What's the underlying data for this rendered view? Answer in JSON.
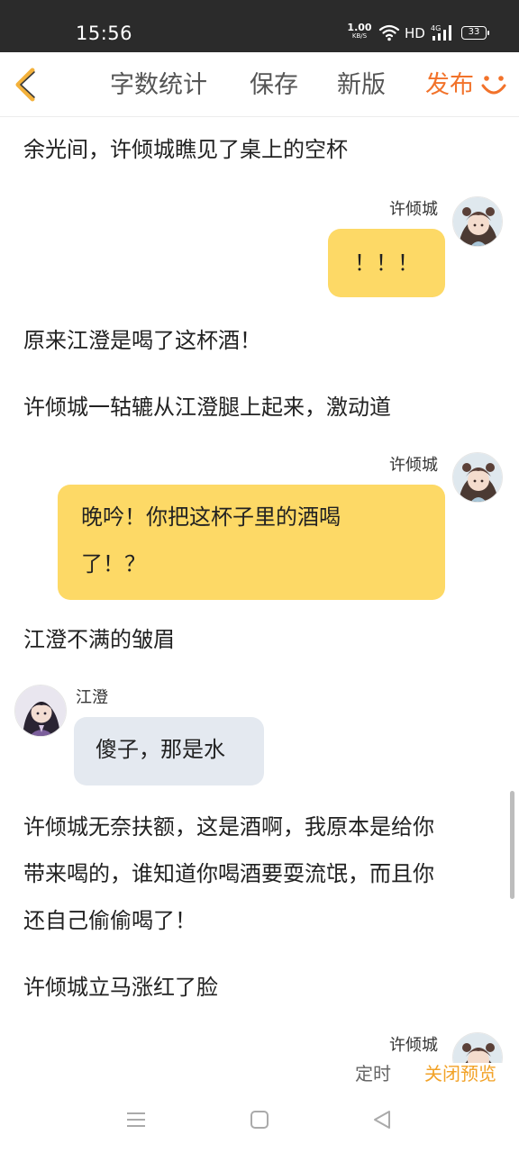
{
  "status_bar": {
    "time": "15:56",
    "net_speed_value": "1.00",
    "net_speed_unit": "KB/S",
    "hd_label": "HD",
    "signal_label": "4G",
    "battery_level": "33"
  },
  "toolbar": {
    "word_count_label": "字数统计",
    "save_label": "保存",
    "new_version_label": "新版",
    "publish_label": "发布"
  },
  "story": {
    "paragraphs": [
      "余光间，许倾城瞧见了桌上的空杯",
      "原来江澄是喝了这杯酒！",
      "许倾城一轱辘从江澄腿上起来，激动道",
      "江澄不满的皱眉",
      "许倾城无奈扶额，这是酒啊，我原本是给你",
      "带来喝的，谁知道你喝酒要耍流氓，而且你",
      "还自己偷偷喝了！",
      "许倾城立马涨红了脸"
    ],
    "messages": [
      {
        "speaker": "许倾城",
        "text": "！！！"
      },
      {
        "speaker": "许倾城",
        "line1": "晚吟！你把这杯子里的酒喝",
        "line2": "了！？"
      },
      {
        "speaker": "江澄",
        "text": "傻子，那是水"
      },
      {
        "speaker": "许倾城"
      }
    ]
  },
  "bottom_actions": {
    "schedule_label": "定时",
    "close_preview_label": "关闭预览"
  },
  "colors": {
    "accent_orange": "#f2722a",
    "bubble_yellow": "#fdd966",
    "bubble_grey": "#e4e9f0",
    "close_preview": "#f2a227"
  },
  "icons": {
    "back": "chevron-left-icon",
    "smile": "smile-icon",
    "nav_menu": "menu-icon",
    "nav_home": "home-square-icon",
    "nav_back": "triangle-back-icon"
  }
}
